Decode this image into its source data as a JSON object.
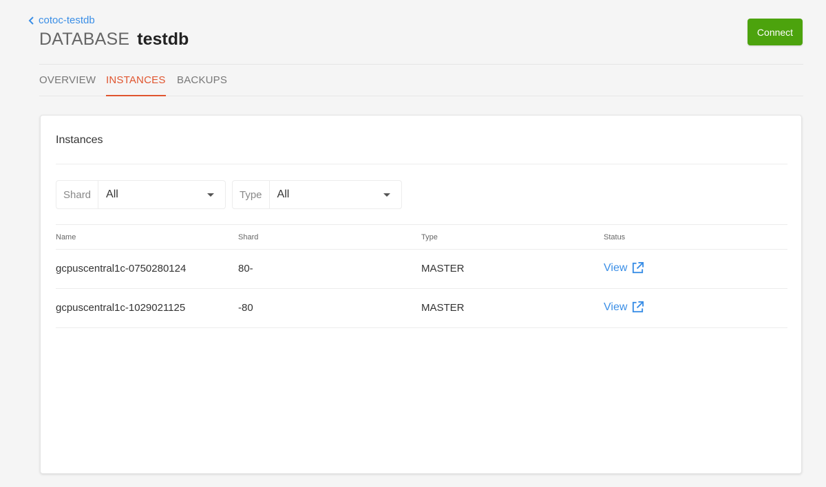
{
  "breadcrumb": {
    "back_label": "cotoc-testdb"
  },
  "header": {
    "kind": "DATABASE",
    "name": "testdb",
    "connect_label": "Connect"
  },
  "tabs": [
    {
      "label": "OVERVIEW",
      "active": false
    },
    {
      "label": "INSTANCES",
      "active": true
    },
    {
      "label": "BACKUPS",
      "active": false
    }
  ],
  "card": {
    "title": "Instances",
    "filters": [
      {
        "label": "Shard",
        "value": "All"
      },
      {
        "label": "Type",
        "value": "All"
      }
    ],
    "columns": [
      "Name",
      "Shard",
      "Type",
      "Status"
    ],
    "rows": [
      {
        "name": "gcpuscentral1c-0750280124",
        "shard": "80-",
        "type": "MASTER",
        "status": "View"
      },
      {
        "name": "gcpuscentral1c-1029021125",
        "shard": "-80",
        "type": "MASTER",
        "status": "View"
      }
    ]
  },
  "icons": {
    "back": "chevron-left-icon",
    "filter_dropdown": "caret-down-icon",
    "view": "external-link-icon"
  },
  "colors": {
    "accent": "#e0552f",
    "link": "#3a8ee6",
    "primary_button": "#4ca30d",
    "background": "#f5f5f5"
  }
}
